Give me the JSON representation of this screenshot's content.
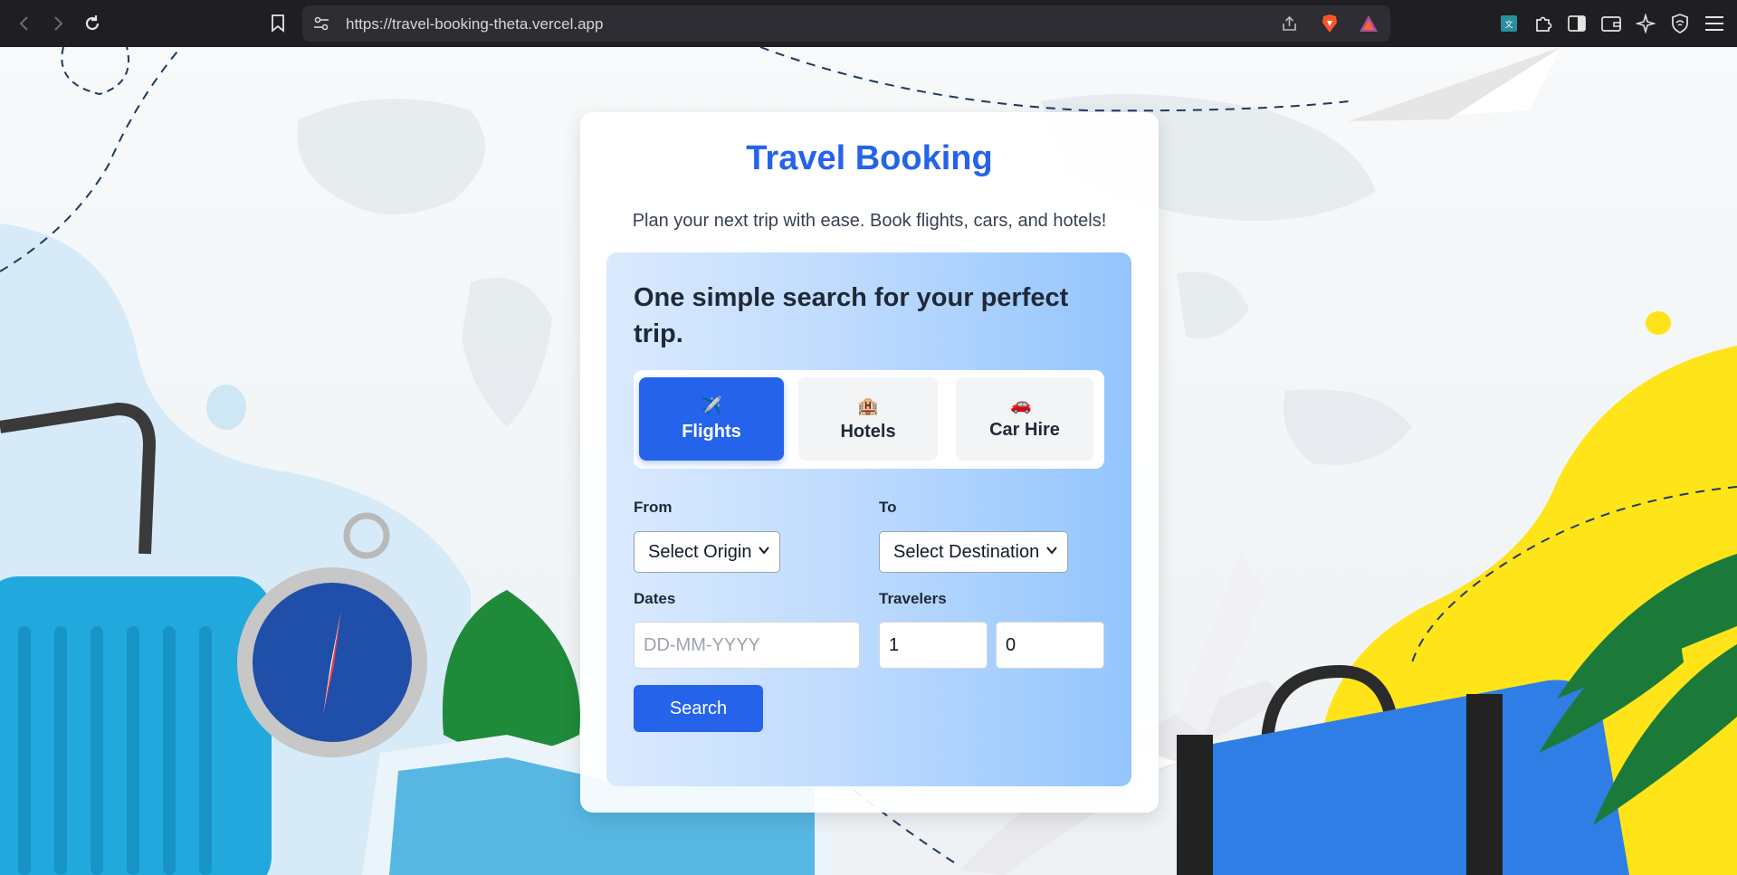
{
  "browser": {
    "url": "https://travel-booking-theta.vercel.app"
  },
  "icons": {
    "back": "back-arrow-icon",
    "forward": "forward-arrow-icon",
    "reload": "reload-icon",
    "bookmark": "bookmark-icon",
    "site_settings": "site-settings-icon",
    "share": "share-icon",
    "brave_shields": "brave-lion-icon",
    "brave_rewards": "brave-rewards-triangle-icon",
    "translate": "translate-extension-icon",
    "extensions": "puzzle-icon",
    "sidebar": "sidebar-icon",
    "wallet": "wallet-icon",
    "leo": "sparkle-icon",
    "vpn": "shield-icon",
    "menu": "hamburger-menu-icon"
  },
  "colors": {
    "accent": "#2563eb",
    "panel_gradient_start": "#dbeafe",
    "panel_gradient_end": "#93c5fd"
  },
  "page": {
    "title": "Travel Booking",
    "subtitle": "Plan your next trip with ease. Book flights, cars, and hotels!"
  },
  "search": {
    "heading": "One simple search for your perfect trip.",
    "tabs": [
      {
        "icon": "✈️",
        "label": "Flights",
        "active": true
      },
      {
        "icon": "🏨",
        "label": "Hotels",
        "active": false
      },
      {
        "icon": "🚗",
        "label": "Car Hire",
        "active": false
      }
    ],
    "from_label": "From",
    "from_value": "Select Origin",
    "to_label": "To",
    "to_value": "Select Destination",
    "dates_label": "Dates",
    "dates_placeholder": "DD-MM-YYYY",
    "travelers_label": "Travelers",
    "adults_value": "1",
    "children_value": "0",
    "button_label": "Search"
  }
}
